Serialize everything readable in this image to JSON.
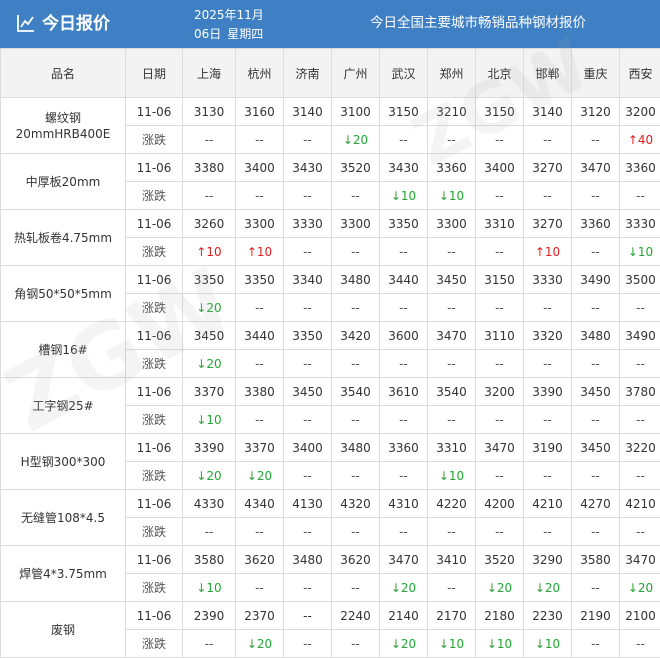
{
  "header": {
    "icon": "chart-icon",
    "title": "今日报价",
    "date_line1": "2025年11月",
    "day": "06日",
    "weekday": "星期四",
    "subtitle": "今日全国主要城市畅销品种钢材报价",
    "bg_color": "#3f7fc3"
  },
  "table": {
    "col_name": "品名",
    "col_date": "日期",
    "cities": [
      "上海",
      "杭州",
      "济南",
      "广州",
      "武汉",
      "郑州",
      "北京",
      "邯郸",
      "重庆",
      "西安"
    ],
    "change_label": "涨跌",
    "up_color": "#e02020",
    "down_color": "#23a636",
    "products": [
      {
        "name": "螺纹钢\n20mmHRB400E",
        "date": "11-06",
        "prices": [
          "3130",
          "3160",
          "3140",
          "3100",
          "3150",
          "3210",
          "3150",
          "3140",
          "3120",
          "3200"
        ],
        "changes": [
          "--",
          "--",
          "--",
          "↓20",
          "--",
          "--",
          "--",
          "--",
          "--",
          "↑40"
        ]
      },
      {
        "name": "中厚板20mm",
        "date": "11-06",
        "prices": [
          "3380",
          "3400",
          "3430",
          "3520",
          "3430",
          "3360",
          "3400",
          "3270",
          "3470",
          "3360"
        ],
        "changes": [
          "--",
          "--",
          "--",
          "--",
          "↓10",
          "↓10",
          "--",
          "--",
          "--",
          "--"
        ]
      },
      {
        "name": "热轧板卷4.75mm",
        "date": "11-06",
        "prices": [
          "3260",
          "3300",
          "3330",
          "3300",
          "3350",
          "3300",
          "3310",
          "3270",
          "3360",
          "3330"
        ],
        "changes": [
          "↑10",
          "↑10",
          "--",
          "--",
          "--",
          "--",
          "--",
          "↑10",
          "--",
          "↓10"
        ]
      },
      {
        "name": "角钢50*50*5mm",
        "date": "11-06",
        "prices": [
          "3350",
          "3350",
          "3340",
          "3480",
          "3440",
          "3450",
          "3150",
          "3330",
          "3490",
          "3500"
        ],
        "changes": [
          "↓20",
          "--",
          "--",
          "--",
          "--",
          "--",
          "--",
          "--",
          "--",
          "--"
        ]
      },
      {
        "name": "槽钢16#",
        "date": "11-06",
        "prices": [
          "3450",
          "3440",
          "3350",
          "3420",
          "3600",
          "3470",
          "3110",
          "3320",
          "3480",
          "3490"
        ],
        "changes": [
          "↓20",
          "--",
          "--",
          "--",
          "--",
          "--",
          "--",
          "--",
          "--",
          "--"
        ]
      },
      {
        "name": "工字钢25#",
        "date": "11-06",
        "prices": [
          "3370",
          "3380",
          "3450",
          "3540",
          "3610",
          "3540",
          "3200",
          "3390",
          "3450",
          "3780"
        ],
        "changes": [
          "↓10",
          "--",
          "--",
          "--",
          "--",
          "--",
          "--",
          "--",
          "--",
          "--"
        ]
      },
      {
        "name": "H型钢300*300",
        "date": "11-06",
        "prices": [
          "3390",
          "3370",
          "3400",
          "3480",
          "3360",
          "3310",
          "3470",
          "3190",
          "3450",
          "3220"
        ],
        "changes": [
          "↓20",
          "↓20",
          "--",
          "--",
          "--",
          "↓10",
          "--",
          "--",
          "--",
          "--"
        ]
      },
      {
        "name": "无缝管108*4.5",
        "date": "11-06",
        "prices": [
          "4330",
          "4340",
          "4130",
          "4320",
          "4310",
          "4220",
          "4200",
          "4210",
          "4270",
          "4210"
        ],
        "changes": [
          "--",
          "--",
          "--",
          "--",
          "--",
          "--",
          "--",
          "--",
          "--",
          "--"
        ]
      },
      {
        "name": "焊管4*3.75mm",
        "date": "11-06",
        "prices": [
          "3580",
          "3620",
          "3480",
          "3620",
          "3470",
          "3410",
          "3520",
          "3290",
          "3580",
          "3470"
        ],
        "changes": [
          "↓10",
          "--",
          "--",
          "--",
          "↓20",
          "--",
          "↓20",
          "↓20",
          "--",
          "↓20"
        ]
      },
      {
        "name": "废钢",
        "date": "11-06",
        "prices": [
          "2390",
          "2370",
          "--",
          "2240",
          "2140",
          "2170",
          "2180",
          "2230",
          "2190",
          "2100"
        ],
        "changes": [
          "--",
          "↓20",
          "--",
          "--",
          "↓20",
          "↓10",
          "↓10",
          "↓10",
          "--",
          "--"
        ]
      }
    ]
  }
}
